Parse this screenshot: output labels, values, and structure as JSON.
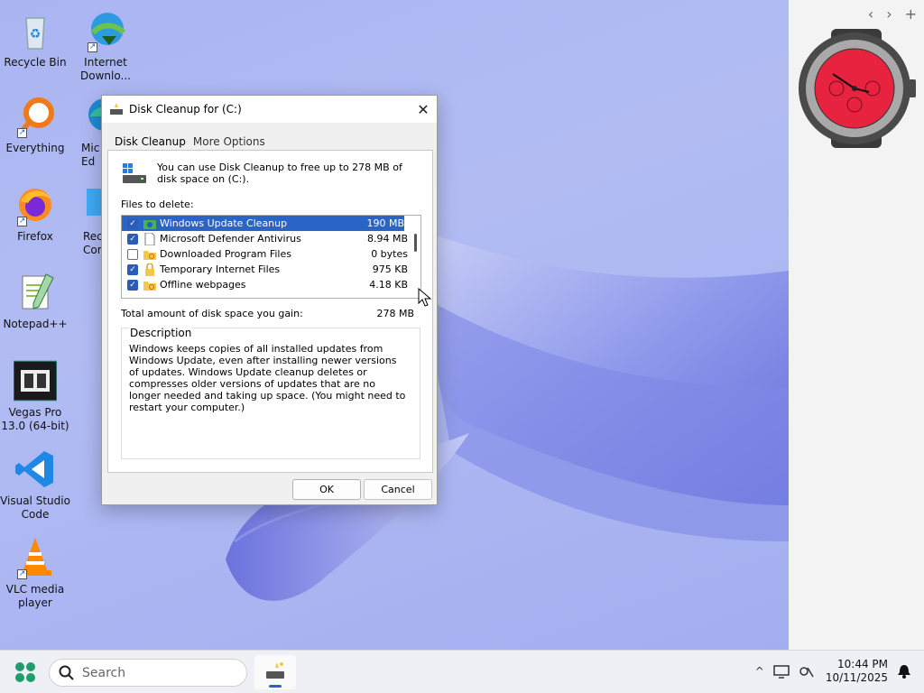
{
  "desktop_icons": [
    {
      "label": "Recycle Bin",
      "icon": "recycle-bin-icon"
    },
    {
      "label": "Internet Downlo...",
      "icon": "internet-download-manager-icon"
    },
    {
      "label": "Everything",
      "icon": "everything-search-icon"
    },
    {
      "label": "Mic Ed",
      "icon": "edge-icon"
    },
    {
      "label": "Firefox",
      "icon": "firefox-icon"
    },
    {
      "label": "Rec Cor",
      "icon": "recorder-icon"
    },
    {
      "label": "Notepad++",
      "icon": "notepadpp-icon"
    },
    {
      "label": "Vegas Pro 13.0 (64-bit)",
      "icon": "vegas-pro-icon"
    },
    {
      "label": "Visual Studio Code",
      "icon": "vscode-icon"
    },
    {
      "label": "VLC media player",
      "icon": "vlc-icon"
    }
  ],
  "widget_panel": {
    "prev": "‹",
    "next": "›",
    "add": "+"
  },
  "dialog": {
    "title": "Disk Cleanup for  (C:)",
    "close": "✕",
    "tabs": [
      {
        "label": "Disk Cleanup",
        "active": true
      },
      {
        "label": "More Options",
        "active": false
      }
    ],
    "intro": "You can use Disk Cleanup to free up to 278 MB of disk space on  (C:).",
    "files_label": "Files to delete:",
    "files": [
      {
        "name": "Windows Update Cleanup",
        "size": "190 MB",
        "checked": true,
        "selected": true
      },
      {
        "name": "Microsoft Defender Antivirus",
        "size": "8.94 MB",
        "checked": true,
        "selected": false
      },
      {
        "name": "Downloaded Program Files",
        "size": "0 bytes",
        "checked": false,
        "selected": false
      },
      {
        "name": "Temporary Internet Files",
        "size": "975 KB",
        "checked": true,
        "selected": false
      },
      {
        "name": "Offline webpages",
        "size": "4.18 KB",
        "checked": true,
        "selected": false
      }
    ],
    "total_label": "Total amount of disk space you gain:",
    "total_value": "278 MB",
    "description_label": "Description",
    "description": "Windows keeps copies of all installed updates from Windows Update, even after installing newer versions of updates. Windows Update cleanup deletes or compresses older versions of updates that are no longer needed and taking up space. (You might need to restart your computer.)",
    "ok": "OK",
    "cancel": "Cancel"
  },
  "taskbar": {
    "search_placeholder": "Search",
    "tray_chevron": "^",
    "time": "10:44 PM",
    "date": "10/11/2025"
  },
  "colors": {
    "accent": "#2a64c5",
    "checkbox": "#2a5db7"
  }
}
